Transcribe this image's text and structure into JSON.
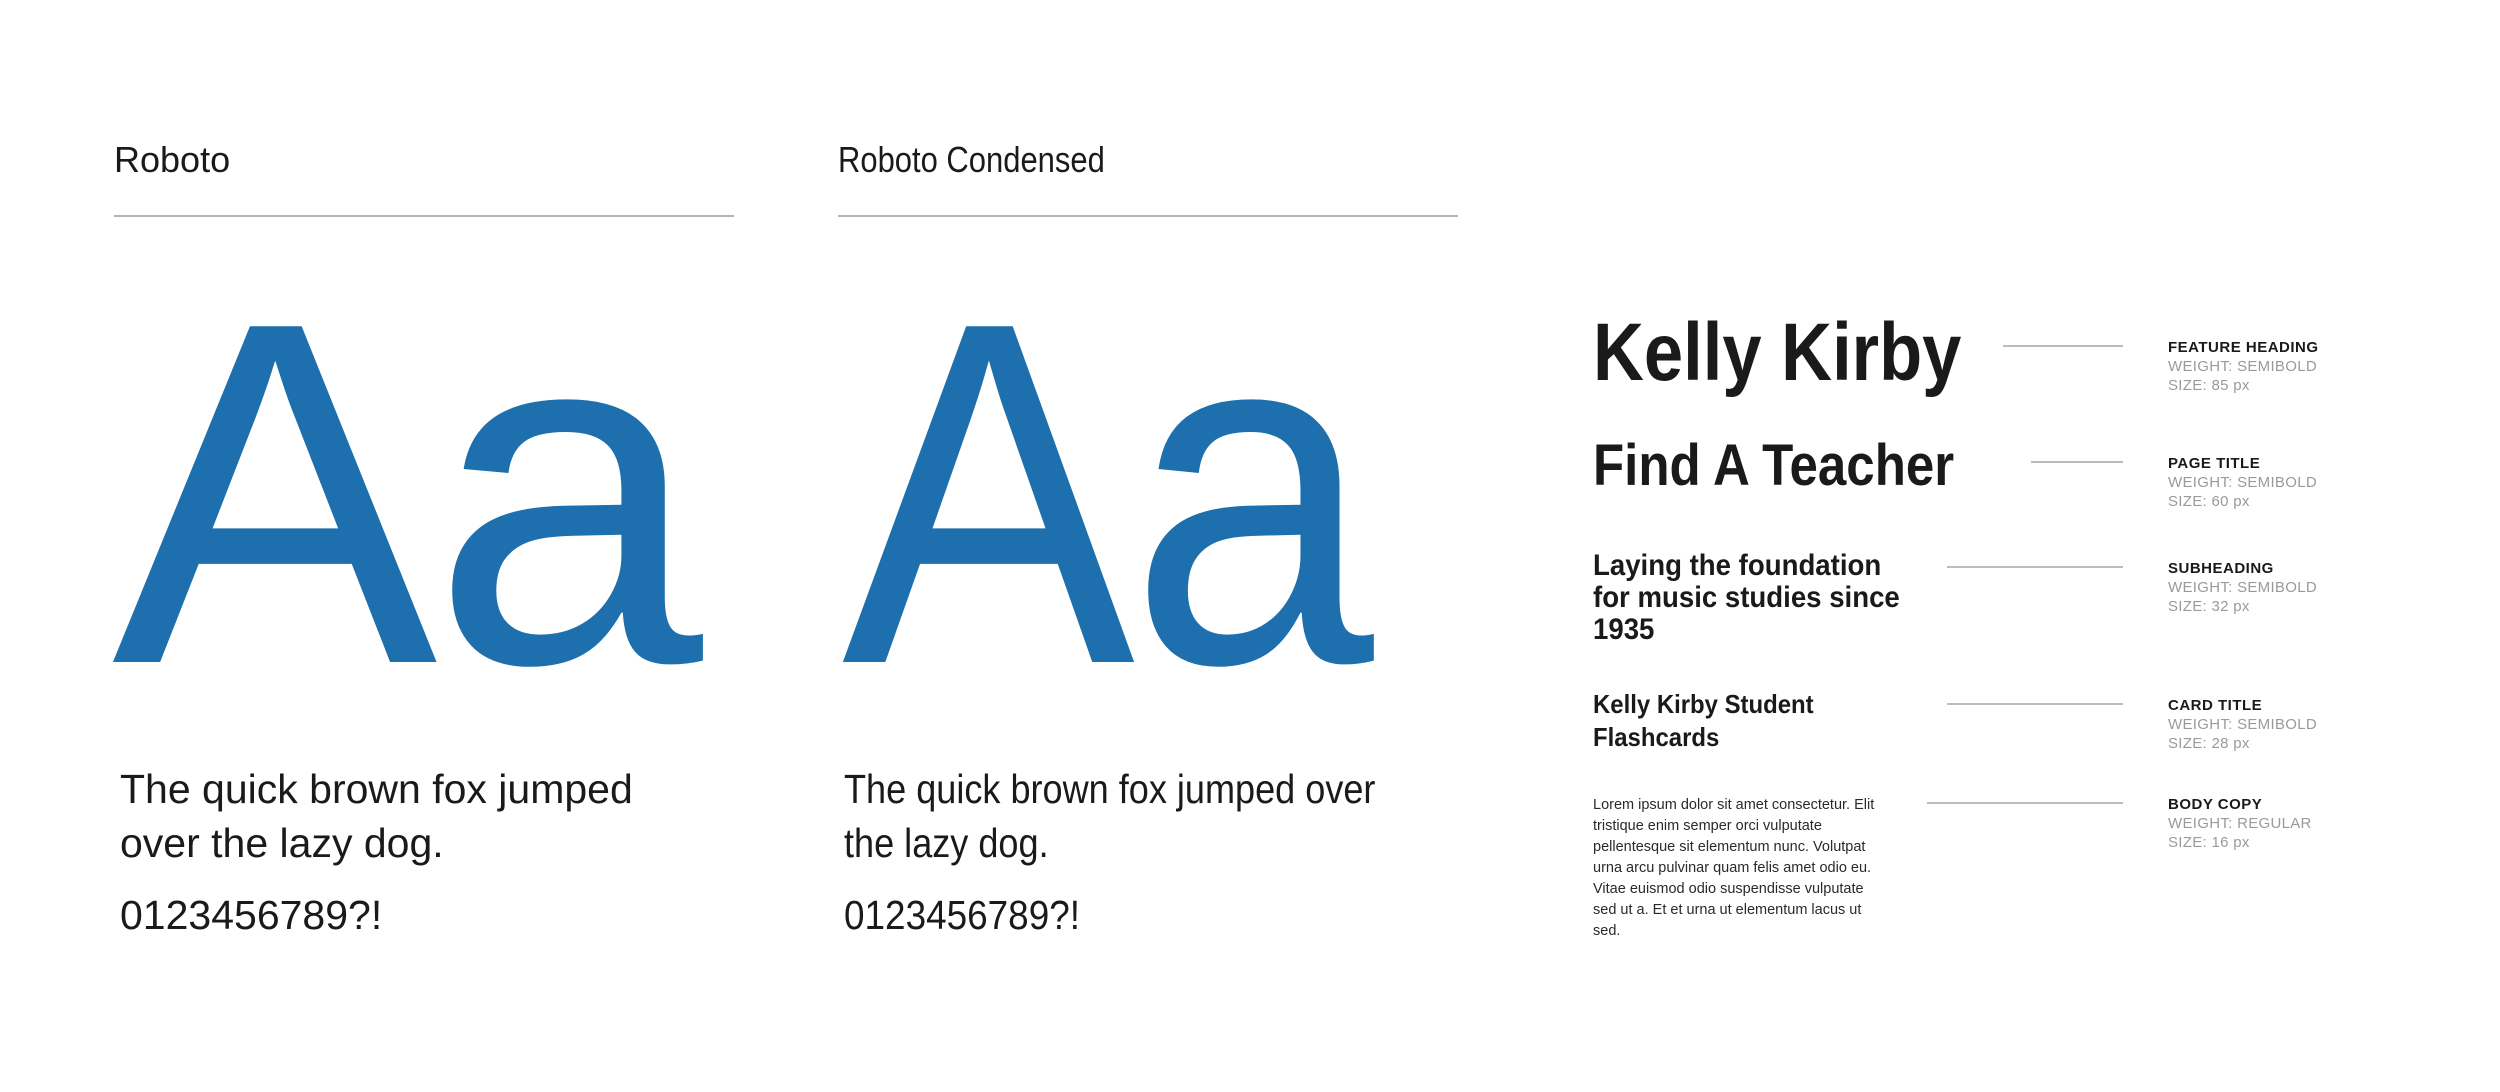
{
  "specimens": [
    {
      "font_name": "Roboto",
      "glyphs": "Aa",
      "pangram": "The quick brown fox jumped over the lazy dog.",
      "digits": "0123456789?!"
    },
    {
      "font_name": "Roboto Condensed",
      "glyphs": "Aa",
      "pangram": "The quick brown fox jumped over the lazy dog.",
      "digits": "0123456789?!"
    }
  ],
  "type_scale": [
    {
      "sample": "Kelly Kirby",
      "label": "FEATURE HEADING",
      "weight": "WEIGHT: SEMIBOLD",
      "size": "SIZE: 85 px"
    },
    {
      "sample": "Find A Teacher",
      "label": "PAGE TITLE",
      "weight": "WEIGHT: SEMIBOLD",
      "size": "SIZE: 60 px"
    },
    {
      "sample": "Laying the foundation for music studies since 1935",
      "label": "SUBHEADING",
      "weight": "WEIGHT: SEMIBOLD",
      "size": "SIZE: 32 px"
    },
    {
      "sample": "Kelly Kirby Student Flashcards",
      "label": "CARD TITLE",
      "weight": "WEIGHT: SEMIBOLD",
      "size": "SIZE: 28 px"
    },
    {
      "sample": "Lorem ipsum dolor sit amet consectetur. Elit tristique enim semper orci vulputate pellentesque sit elementum nunc. Volutpat urna arcu pulvinar quam felis amet odio eu. Vitae euismod odio suspendisse vulputate sed ut a. Et et urna ut elementum lacus ut sed.",
      "label": "BODY COPY",
      "weight": "WEIGHT: REGULAR",
      "size": "SIZE: 16 px"
    }
  ],
  "colors": {
    "accent": "#1d70ad",
    "text": "#1a1a1a",
    "muted": "#9a9a9a",
    "rule": "#b5b5b5"
  }
}
